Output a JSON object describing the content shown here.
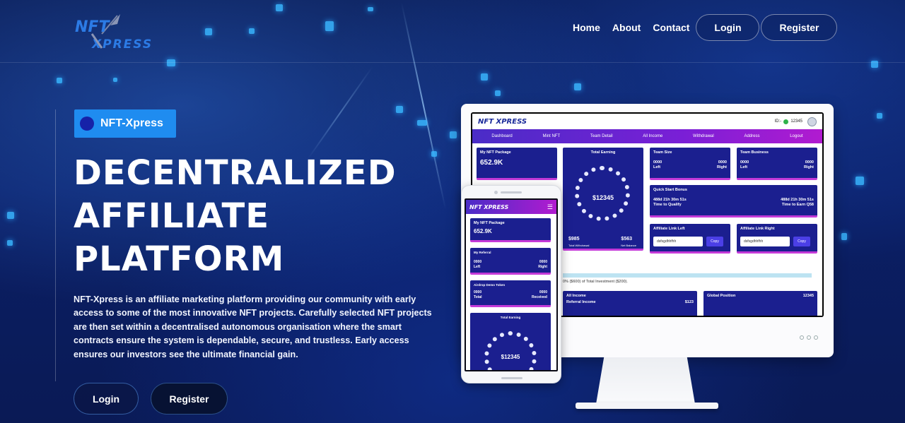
{
  "brand": {
    "logo_alt": "NFT-Xpress logo"
  },
  "nav": {
    "links": [
      "Home",
      "About",
      "Contact"
    ],
    "login_label": "Login",
    "register_label": "Register"
  },
  "hero": {
    "badge": "NFT-Xpress",
    "title_lines": [
      "DECENTRALIZED",
      "AFFILIATE",
      "PLATFORM"
    ],
    "description": "NFT-Xpress is an affiliate marketing platform providing our community with early access to some of the most innovative NFT projects. Carefully selected NFT projects are then set within a decentralised autonomous organisation where the smart contracts ensure the system is dependable, secure, and trustless. Early access ensures our investors see the ultimate financial gain.",
    "login_label": "Login",
    "register_label": "Register"
  },
  "mockup": {
    "desktop": {
      "logo": "NFT XPRESS",
      "id_label": "ID:-",
      "id_value": "12345",
      "menu": [
        "Dashboard",
        "Mint NFT",
        "Team Detail",
        "All Income",
        "Withdrawal",
        "Address",
        "Logout"
      ],
      "nft_package": {
        "title": "My NFT Package",
        "value": "652.9K"
      },
      "total_earning": {
        "title": "Total Earning",
        "value": "$12345",
        "withdrawal_value": "$985",
        "withdrawal_label": "Total Withdrawal",
        "balance_value": "$563",
        "balance_label": "Net Balance"
      },
      "team_size": {
        "title": "Team Size",
        "left_value": "0000",
        "right_value": "0000",
        "left_label": "Left",
        "right_label": "Right"
      },
      "team_business": {
        "title": "Team Business",
        "left_value": "0000",
        "right_value": "0000",
        "left_label": "Left",
        "right_label": "Right"
      },
      "quick_start": {
        "title": "Quick Start Bonus",
        "left_time": "488d 21h 30m 51s",
        "right_time": "488d 21h 30m 51s",
        "left_label": "Time to Qualify",
        "right_label": "Time to Earn Q58"
      },
      "affiliate_left": {
        "title": "Affiliate Link Left",
        "value": "dsfsgdhhfhh",
        "button": "Copy"
      },
      "affiliate_right": {
        "title": "Affiliate Link Right",
        "value": "dsfsgdhhfhh",
        "button": "Copy"
      },
      "progress_note": "0% ($600) of Total Investment ($200).",
      "all_income": {
        "title": "All Income",
        "sub": "Referral Income",
        "value": "$123"
      },
      "global_position": {
        "title": "Global Position",
        "value": "12345"
      }
    },
    "phone": {
      "logo": "NFT XPRESS",
      "nft_package": {
        "title": "My NFT Package",
        "value": "652.9K"
      },
      "referral": {
        "title": "My Referral",
        "left_value": "0000",
        "right_value": "0000",
        "left_label": "Left",
        "right_label": "Right"
      },
      "airdrop": {
        "title": "Airdrop Demo Token",
        "left_value": "0000",
        "right_value": "0000",
        "left_label": "Total",
        "right_label": "Received"
      },
      "total_earning": {
        "title": "Total Earning",
        "value": "$12345"
      }
    }
  },
  "colors": {
    "accent": "#1f8cf0",
    "background": "#0b1f66",
    "card": "#1b1f8f",
    "menu_gradient_start": "#4a2cc7",
    "menu_gradient_end": "#b11bd0"
  }
}
